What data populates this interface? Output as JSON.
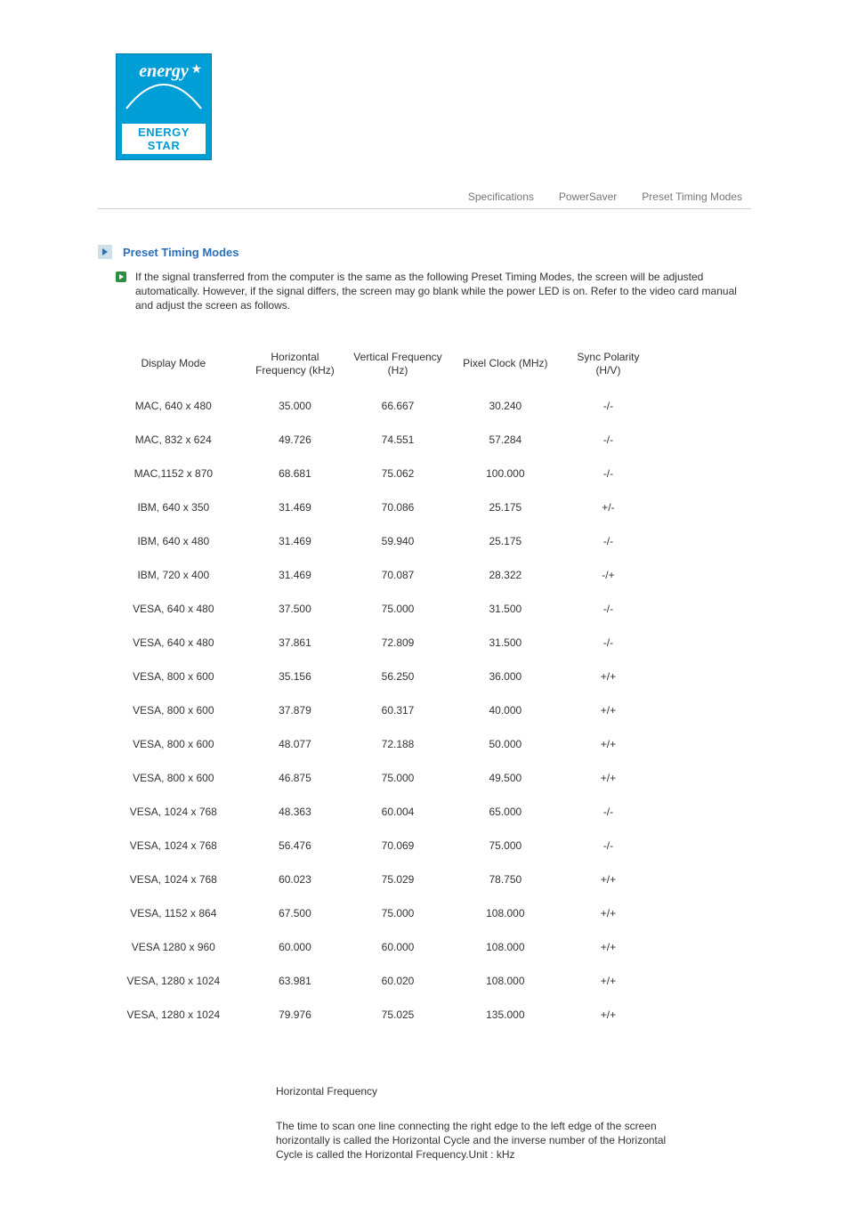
{
  "logo": {
    "script": "energy",
    "label": "ENERGY STAR"
  },
  "nav": {
    "specifications": "Specifications",
    "powersaver": "PowerSaver",
    "preset": "Preset Timing Modes"
  },
  "section": {
    "title": "Preset Timing Modes",
    "description": "If the signal transferred from the computer is the same as the following Preset Timing Modes, the screen will be adjusted automatically. However, if the signal differs, the screen may go blank while the power LED is on. Refer to the video card manual and adjust the screen as follows."
  },
  "headers": {
    "display_mode": "Display Mode",
    "h_freq": "Horizontal Frequency (kHz)",
    "v_freq": "Vertical Frequency (Hz)",
    "pixel_clock": "Pixel Clock (MHz)",
    "sync": "Sync Polarity (H/V)"
  },
  "rows": [
    {
      "mode": "MAC, 640 x 480",
      "h": "35.000",
      "v": "66.667",
      "clk": "30.240",
      "sync": "-/-"
    },
    {
      "mode": "MAC, 832 x 624",
      "h": "49.726",
      "v": "74.551",
      "clk": "57.284",
      "sync": "-/-"
    },
    {
      "mode": "MAC,1152 x 870",
      "h": "68.681",
      "v": "75.062",
      "clk": "100.000",
      "sync": "-/-"
    },
    {
      "mode": "IBM, 640 x 350",
      "h": "31.469",
      "v": "70.086",
      "clk": "25.175",
      "sync": "+/-"
    },
    {
      "mode": "IBM, 640 x 480",
      "h": "31.469",
      "v": "59.940",
      "clk": "25.175",
      "sync": "-/-"
    },
    {
      "mode": "IBM, 720 x 400",
      "h": "31.469",
      "v": "70.087",
      "clk": "28.322",
      "sync": "-/+"
    },
    {
      "mode": "VESA, 640 x 480",
      "h": "37.500",
      "v": "75.000",
      "clk": "31.500",
      "sync": "-/-"
    },
    {
      "mode": "VESA, 640 x 480",
      "h": "37.861",
      "v": "72.809",
      "clk": "31.500",
      "sync": "-/-"
    },
    {
      "mode": "VESA, 800 x 600",
      "h": "35.156",
      "v": "56.250",
      "clk": "36.000",
      "sync": "+/+"
    },
    {
      "mode": "VESA, 800 x 600",
      "h": "37.879",
      "v": "60.317",
      "clk": "40.000",
      "sync": "+/+"
    },
    {
      "mode": "VESA, 800 x 600",
      "h": "48.077",
      "v": "72.188",
      "clk": "50.000",
      "sync": "+/+"
    },
    {
      "mode": "VESA, 800 x 600",
      "h": "46.875",
      "v": "75.000",
      "clk": "49.500",
      "sync": "+/+"
    },
    {
      "mode": "VESA, 1024 x 768",
      "h": "48.363",
      "v": "60.004",
      "clk": "65.000",
      "sync": "-/-"
    },
    {
      "mode": "VESA, 1024 x 768",
      "h": "56.476",
      "v": "70.069",
      "clk": "75.000",
      "sync": "-/-"
    },
    {
      "mode": "VESA, 1024 x 768",
      "h": "60.023",
      "v": "75.029",
      "clk": "78.750",
      "sync": "+/+"
    },
    {
      "mode": "VESA, 1152 x 864",
      "h": "67.500",
      "v": "75.000",
      "clk": "108.000",
      "sync": "+/+"
    },
    {
      "mode": "VESA 1280 x 960",
      "h": "60.000",
      "v": "60.000",
      "clk": "108.000",
      "sync": "+/+"
    },
    {
      "mode": "VESA, 1280 x 1024",
      "h": "63.981",
      "v": "60.020",
      "clk": "108.000",
      "sync": "+/+"
    },
    {
      "mode": "VESA, 1280 x 1024",
      "h": "79.976",
      "v": "75.025",
      "clk": "135.000",
      "sync": "+/+"
    }
  ],
  "definition": {
    "title": "Horizontal Frequency",
    "body": "The time to scan one line connecting the right edge to the left edge of the screen horizontally is called the Horizontal Cycle and the inverse number of the Horizontal Cycle is called the Horizontal Frequency.Unit : kHz"
  }
}
